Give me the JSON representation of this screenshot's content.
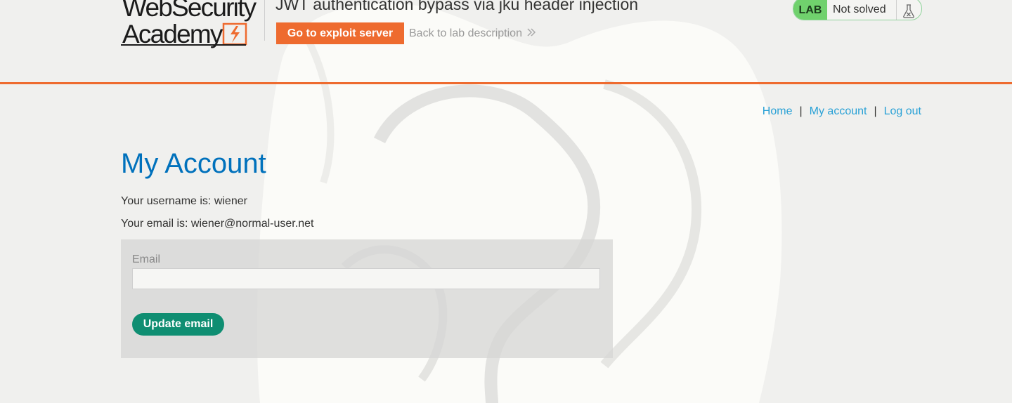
{
  "header": {
    "logo_line1": "WebSecurity",
    "logo_line2": "Academy",
    "lab_title": "JWT authentication bypass via jku header injection",
    "exploit_button_label": "Go to exploit server",
    "back_link_label": "Back to lab description",
    "status": {
      "badge": "LAB",
      "text": "Not solved",
      "icon": "flask-icon"
    }
  },
  "nav": {
    "home": "Home",
    "separator": "|",
    "my_account": "My account",
    "log_out": "Log out"
  },
  "main": {
    "title": "My Account",
    "username_line": "Your username is: wiener",
    "email_line": "Your email is: wiener@normal-user.net",
    "form": {
      "email_label": "Email",
      "email_value": "",
      "email_placeholder": "",
      "submit_label": "Update email"
    }
  },
  "colors": {
    "accent_orange": "#ee6b2f",
    "link_blue": "#29a1d6",
    "title_blue": "#0071bc",
    "button_green": "#0f8e72",
    "lab_badge_green": "#70d16d"
  }
}
